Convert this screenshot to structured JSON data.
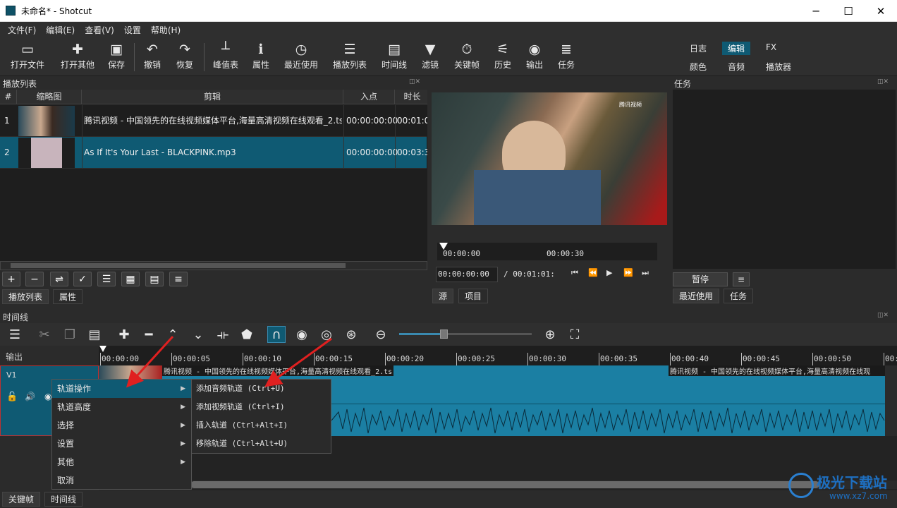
{
  "window": {
    "title": "未命名* - Shotcut",
    "minimize": "─",
    "maximize": "☐",
    "close": "✕"
  },
  "menubar": [
    "文件(F)",
    "编辑(E)",
    "查看(V)",
    "设置",
    "帮助(H)"
  ],
  "toolbar": {
    "open": "打开文件",
    "open_other": "打开其他",
    "save": "保存",
    "undo": "撤销",
    "redo": "恢复",
    "peak": "峰值表",
    "properties": "属性",
    "recent": "最近使用",
    "playlist": "播放列表",
    "timeline": "时间线",
    "filters": "滤镜",
    "keyframes": "关键帧",
    "history": "历史",
    "export": "输出",
    "jobs": "任务",
    "layouts": {
      "row1": [
        "日志",
        "编辑",
        "FX"
      ],
      "row2": [
        "颜色",
        "音频",
        "播放器"
      ],
      "active": "编辑"
    }
  },
  "playlist": {
    "title": "播放列表",
    "columns": [
      "#",
      "缩略图",
      "剪辑",
      "入点",
      "时长"
    ],
    "rows": [
      {
        "num": "1",
        "clip": "腾讯视频 - 中国领先的在线视频媒体平台,海量高清视频在线观看_2.ts",
        "in": "00:00:00:00",
        "dur": "00:01:0"
      },
      {
        "num": "2",
        "clip": "As If It's Your Last - BLACKPINK.mp3",
        "in": "00:00:00:00",
        "dur": "00:03:3"
      }
    ],
    "buttons": [
      "+",
      "−",
      "⇌",
      "✓",
      "☰",
      "▦",
      "▤",
      "≡"
    ],
    "tabs": [
      "播放列表",
      "属性"
    ]
  },
  "player": {
    "video_watermark": "腾讯视频",
    "ruler": [
      "00:00:00",
      "00:00:30"
    ],
    "timecode": "00:00:00:00",
    "duration": "/ 00:01:01:",
    "transport": [
      "⏮",
      "⏪",
      "▶",
      "⏩",
      "⏭"
    ],
    "tabs": [
      "源",
      "项目"
    ]
  },
  "jobs": {
    "title": "任务",
    "pause": "暂停",
    "menu": "≡",
    "tabs": [
      "最近使用",
      "任务"
    ]
  },
  "timeline": {
    "title": "时间线",
    "output_label": "输出",
    "track": "V1",
    "ruler": [
      "00:00:00",
      "00:00:05",
      "00:00:10",
      "00:00:15",
      "00:00:20",
      "00:00:25",
      "00:00:30",
      "00:00:35",
      "00:00:40",
      "00:00:45",
      "00:00:50",
      "00:00:5"
    ],
    "clip_title": "腾讯视频 - 中国领先的在线视频媒体平台,海量高清视频在线观看_2.ts",
    "clip_title_right": "腾讯视频 - 中国领先的在线视频媒体平台,海量高清视频在线观"
  },
  "context_menu": {
    "items": [
      "轨道操作",
      "轨道高度",
      "选择",
      "设置",
      "其他",
      "取消"
    ],
    "submenu": [
      "添加音频轨道 (Ctrl+U)",
      "添加视频轨道 (Ctrl+I)",
      "插入轨道 (Ctrl+Alt+I)",
      "移除轨道 (Ctrl+Alt+U)"
    ]
  },
  "bottom_tabs": [
    "关键帧",
    "时间线"
  ],
  "watermark": {
    "name": "极光下载站",
    "url": "www.xz7.com"
  },
  "colors": {
    "accent": "#0f5a73",
    "clip": "#1b7fa3",
    "arrow": "#e02020"
  }
}
